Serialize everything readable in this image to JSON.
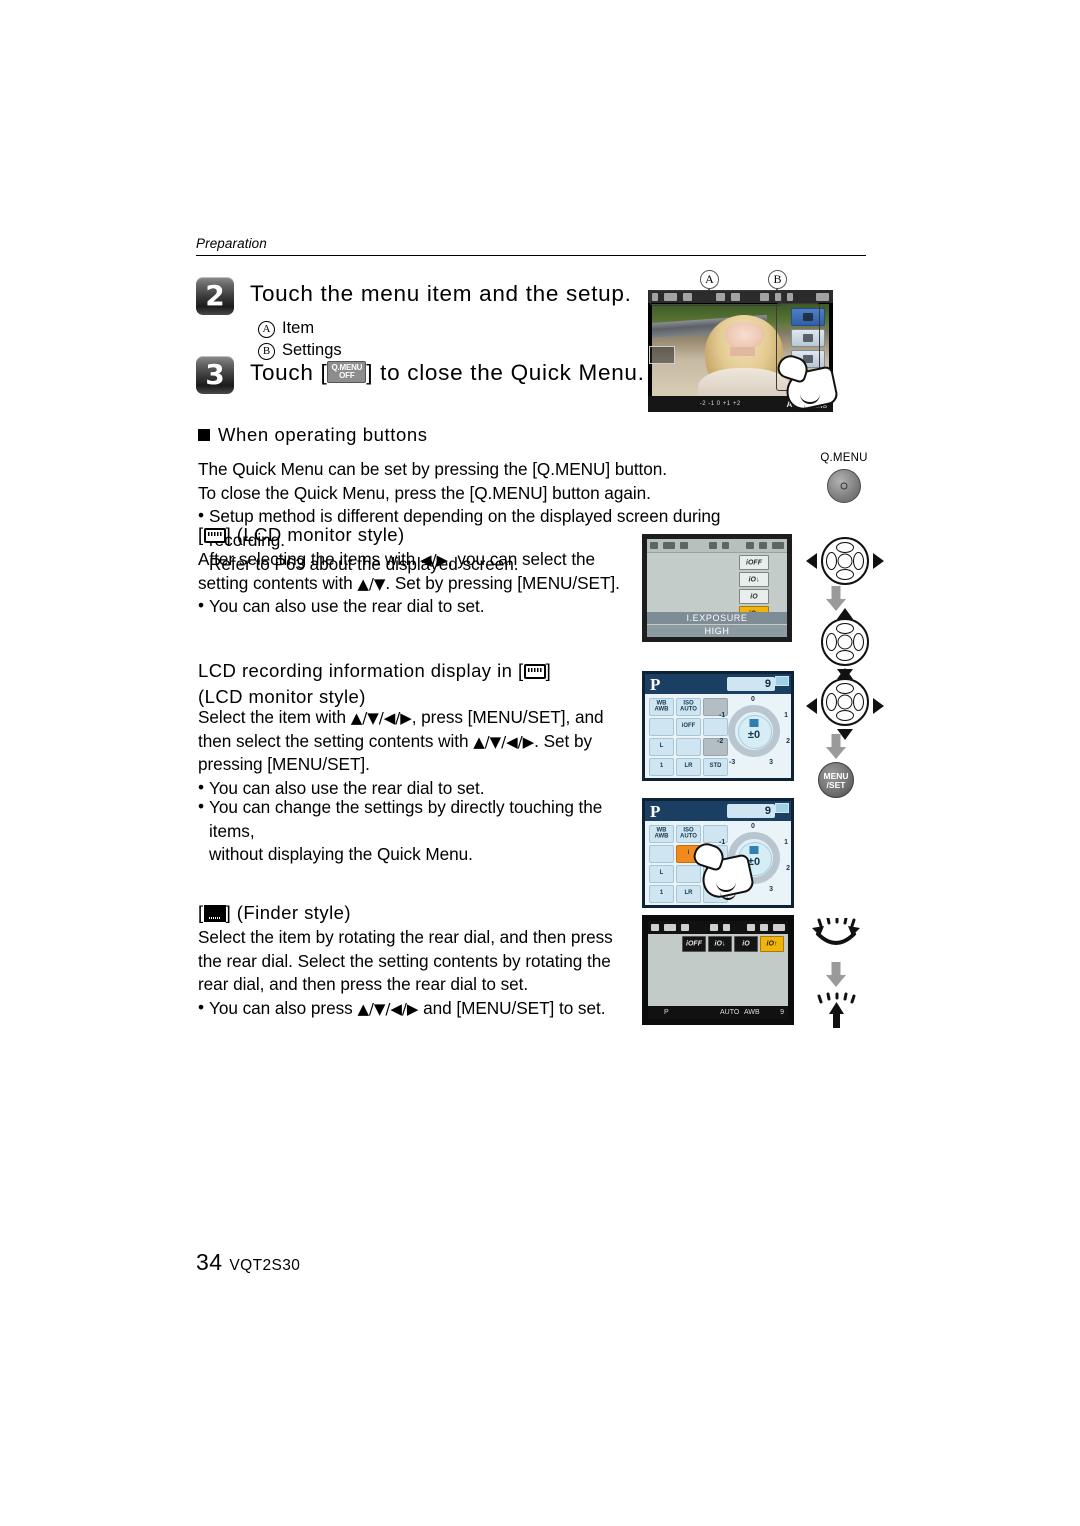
{
  "header": {
    "section_label": "Preparation"
  },
  "steps": [
    {
      "number": "2",
      "text": "Touch the menu item and the setup."
    },
    {
      "number": "3",
      "text_before": "Touch [",
      "chip_line1": "Q.MENU",
      "chip_line2": "OFF",
      "text_after": "] to close the Quick Menu."
    }
  ],
  "callout_list": [
    {
      "marker": "A",
      "label": "Item"
    },
    {
      "marker": "B",
      "label": "Settings"
    }
  ],
  "section": {
    "heading": "When operating buttons"
  },
  "buttons_para": {
    "line1": "The Quick Menu can be set by pressing the [Q.MENU] button.",
    "line2": "To close the Quick Menu, press the [Q.MENU] button again.",
    "bullet1_line1": "Setup method is different depending on the displayed screen during recording.",
    "bullet1_line2": "Refer to P63 about the displayed screen."
  },
  "lcd_style": {
    "title_before": "[",
    "title_after": "] (LCD monitor style)",
    "line1_a": "After selecting the items with ",
    "line1_b": "◀/▶",
    "line1_c": ", you can select the",
    "line2_a": "setting contents with ",
    "line2_b": "▲/▼",
    "line2_c": ". Set by pressing [MENU/SET].",
    "bullet": "You can also use the rear dial to set."
  },
  "lcd_rec_info": {
    "title_a": "LCD recording information display in [",
    "title_b": "]",
    "title_line2": "(LCD monitor style)",
    "line1_a": "Select the item with ",
    "line1_b": "▲/▼/◀/▶",
    "line1_c": ", press [MENU/SET], and",
    "line2_a": "then select the setting contents with ",
    "line2_b": "▲/▼/◀/▶",
    "line2_c": ". Set by",
    "line3": "pressing [MENU/SET].",
    "bullet": "You can also use the rear dial to set."
  },
  "direct_touch": {
    "bullet_line1": "You can change the settings by directly touching the items,",
    "bullet_line2": "without displaying the Quick Menu."
  },
  "finder_style": {
    "title_before": "[",
    "title_after": "] (Finder style)",
    "line1": "Select the item by rotating the rear dial, and then press",
    "line2": "the rear dial. Select the setting contents by rotating the",
    "line3": "rear dial, and then press the rear dial to set.",
    "bullet_a": "You can also press ",
    "bullet_b": "▲/▼/◀/▶",
    "bullet_c": " and [MENU/SET] to set."
  },
  "controls": {
    "qmenu_label": "Q.MENU",
    "menuset_line1": "MENU",
    "menuset_line2": "/SET"
  },
  "screens": {
    "live_view": {
      "exposure_scale": "-2 -1 0 +1 +2",
      "auto": "AUTO",
      "awb": "AWB"
    },
    "lcd_monitor_style": {
      "setting_name": "I.EXPOSURE",
      "setting_value": "HIGH",
      "items": [
        {
          "label": "iOFF",
          "selected": false
        },
        {
          "label": "iO↓",
          "selected": false
        },
        {
          "label": "iO",
          "selected": false
        },
        {
          "label": "iO↑",
          "selected": true
        }
      ]
    },
    "p_info_1": {
      "mode": "P",
      "count": "9",
      "ev": "±0",
      "dial_ticks": [
        "0",
        "1",
        "2",
        "3",
        "-3",
        "-2",
        "-1"
      ],
      "grid": [
        {
          "line1": "WB",
          "line2": "AWB",
          "state": "normal"
        },
        {
          "line1": "ISO",
          "line2": "AUTO",
          "state": "normal"
        },
        {
          "line1": "",
          "line2": "",
          "state": "dim"
        },
        {
          "line1": "",
          "line2": "",
          "state": "normal"
        },
        {
          "line1": "i",
          "line2": "OFF",
          "state": "normal"
        },
        {
          "line1": "",
          "line2": "",
          "state": "normal"
        },
        {
          "line1": "L",
          "line2": "",
          "state": "normal"
        },
        {
          "line1": "",
          "line2": "",
          "state": "normal"
        },
        {
          "line1": "",
          "line2": "",
          "state": "dim"
        },
        {
          "line1": "",
          "line2": "1",
          "state": "normal"
        },
        {
          "line1": "LR",
          "line2": "",
          "state": "normal"
        },
        {
          "line1": "",
          "line2": "STD",
          "state": "normal"
        }
      ]
    },
    "p_info_2": {
      "mode": "P",
      "count": "9",
      "ev": "±0",
      "highlighted_index": 4,
      "grid": [
        {
          "line1": "WB",
          "line2": "AWB",
          "state": "normal"
        },
        {
          "line1": "ISO",
          "line2": "AUTO",
          "state": "normal"
        },
        {
          "line1": "",
          "line2": "",
          "state": "normal"
        },
        {
          "line1": "",
          "line2": "",
          "state": "normal"
        },
        {
          "line1": "i",
          "line2": "",
          "state": "hl"
        },
        {
          "line1": "",
          "line2": "",
          "state": "normal"
        },
        {
          "line1": "L",
          "line2": "",
          "state": "normal"
        },
        {
          "line1": "",
          "line2": "",
          "state": "normal"
        },
        {
          "line1": "",
          "line2": "",
          "state": "normal"
        },
        {
          "line1": "",
          "line2": "1",
          "state": "normal"
        },
        {
          "line1": "LR",
          "line2": "",
          "state": "normal"
        },
        {
          "line1": "",
          "line2": "",
          "state": "normal"
        }
      ]
    },
    "finder_style": {
      "mode": "P",
      "count": "9",
      "auto": "AUTO",
      "awb": "AWB",
      "items": [
        {
          "label": "iOFF",
          "selected": false
        },
        {
          "label": "iO↓",
          "selected": false
        },
        {
          "label": "iO",
          "selected": false
        },
        {
          "label": "iO↑",
          "selected": true
        }
      ]
    }
  },
  "footer": {
    "page_number": "34",
    "doc_code": "VQT2S30"
  }
}
